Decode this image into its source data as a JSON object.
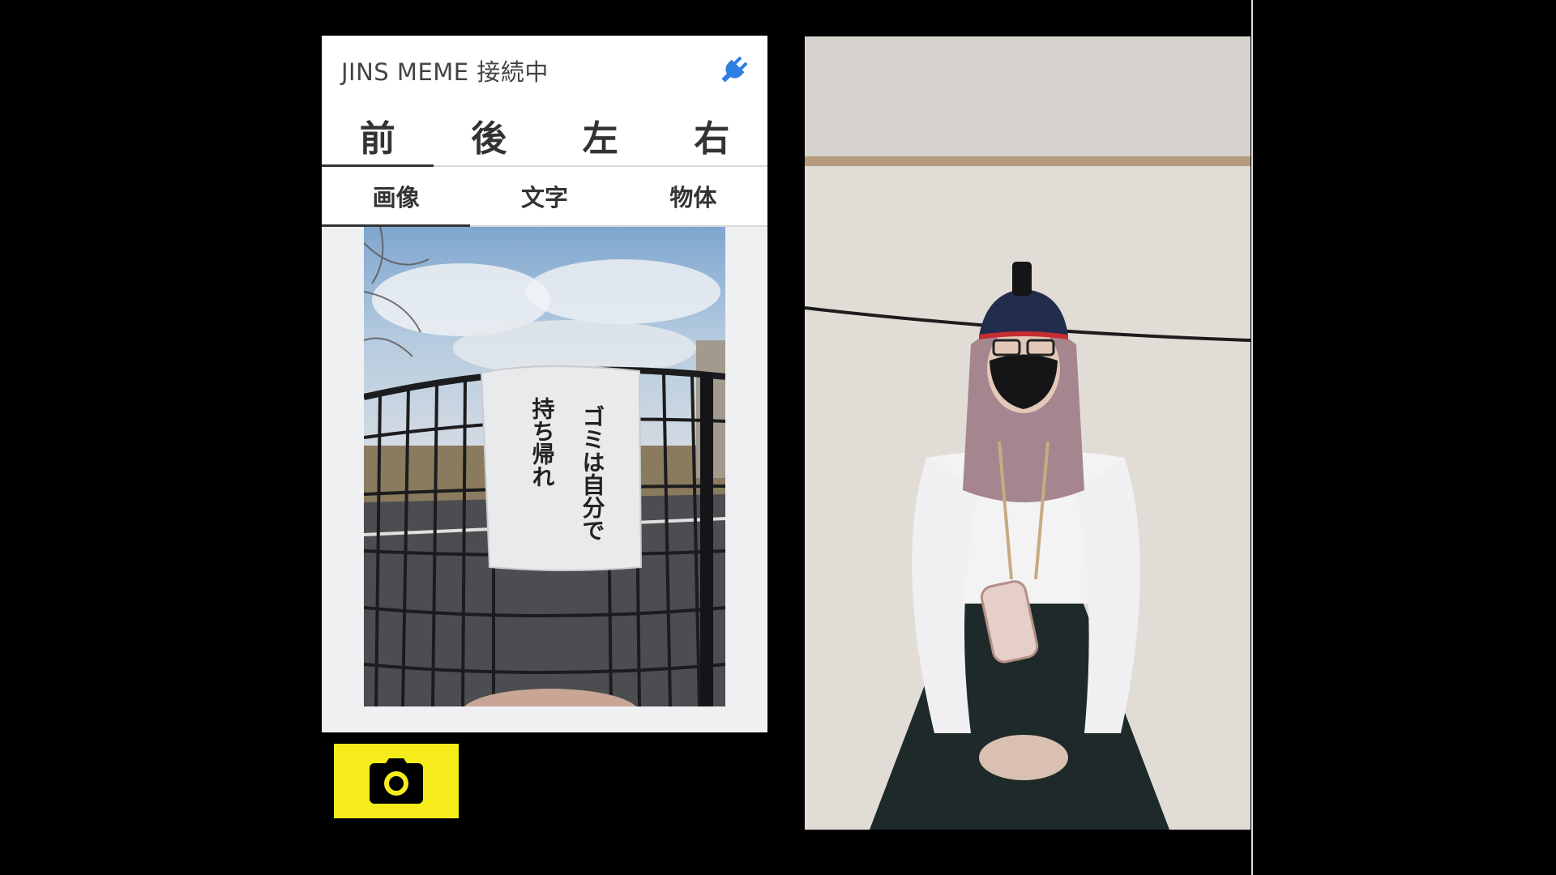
{
  "app": {
    "title": "JINS MEME 接続中",
    "connection_icon": "plug-icon",
    "accent_color": "#2d7ee0",
    "direction_tabs": [
      {
        "label": "前",
        "active": true
      },
      {
        "label": "後",
        "active": false
      },
      {
        "label": "左",
        "active": false
      },
      {
        "label": "右",
        "active": false
      }
    ],
    "mode_tabs": [
      {
        "label": "画像",
        "active": true
      },
      {
        "label": "文字",
        "active": false
      },
      {
        "label": "物体",
        "active": false
      }
    ],
    "photo": {
      "sign_text_col1": "ゴミは自分で",
      "sign_text_col2": "持ち帰れ"
    }
  },
  "camera_button": {
    "icon": "camera-icon",
    "color": "#f6ec1c"
  }
}
